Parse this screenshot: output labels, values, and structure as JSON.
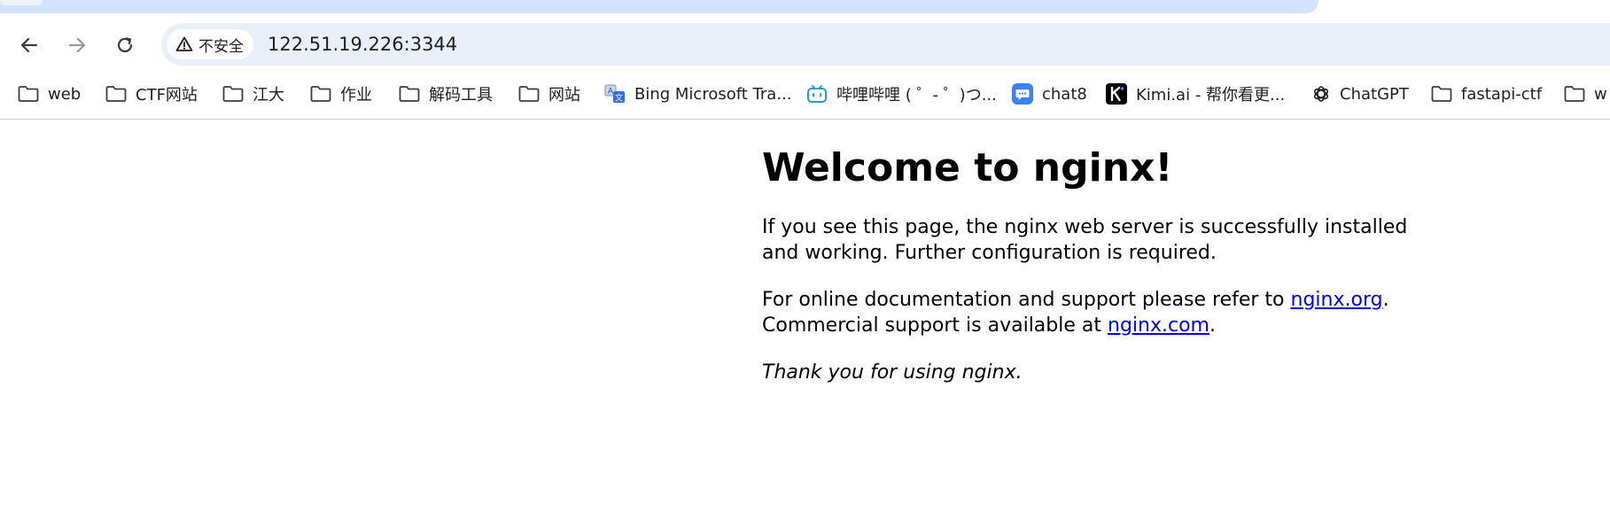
{
  "browser": {
    "security_label": "不安全",
    "url": "122.51.19.226:3344",
    "bookmarks": [
      {
        "label": "web",
        "icon": "folder-icon"
      },
      {
        "label": "CTF网站",
        "icon": "folder-icon"
      },
      {
        "label": "江大",
        "icon": "folder-icon"
      },
      {
        "label": "作业",
        "icon": "folder-icon"
      },
      {
        "label": "解码工具",
        "icon": "folder-icon"
      },
      {
        "label": "网站",
        "icon": "folder-icon"
      },
      {
        "label": "Bing Microsoft Tra...",
        "icon": "translator-icon"
      },
      {
        "label": "哔哩哔哩 ( ゜- ゜)つ...",
        "icon": "bilibili-icon"
      },
      {
        "label": "chat8",
        "icon": "chat-bubble-icon"
      },
      {
        "label": "Kimi.ai - 帮你看更...",
        "icon": "kimi-icon"
      },
      {
        "label": "ChatGPT",
        "icon": "openai-icon"
      },
      {
        "label": "fastapi-ctf",
        "icon": "folder-icon"
      },
      {
        "label": "w",
        "icon": "folder-icon"
      }
    ]
  },
  "page": {
    "title": "Welcome to nginx!",
    "para1": "If you see this page, the nginx web server is successfully installed and working. Further configuration is required.",
    "para2_prefix": "For online documentation and support please refer to ",
    "link_org": "nginx.org",
    "para2_mid": ".",
    "para2_line2": "Commercial support is available at ",
    "link_com": "nginx.com",
    "para2_end": ".",
    "thanks": "Thank you for using nginx."
  },
  "colors": {
    "tab_strip": "#d3e3fd",
    "omnibox": "#eaf0f9",
    "link": "#0000ee"
  }
}
